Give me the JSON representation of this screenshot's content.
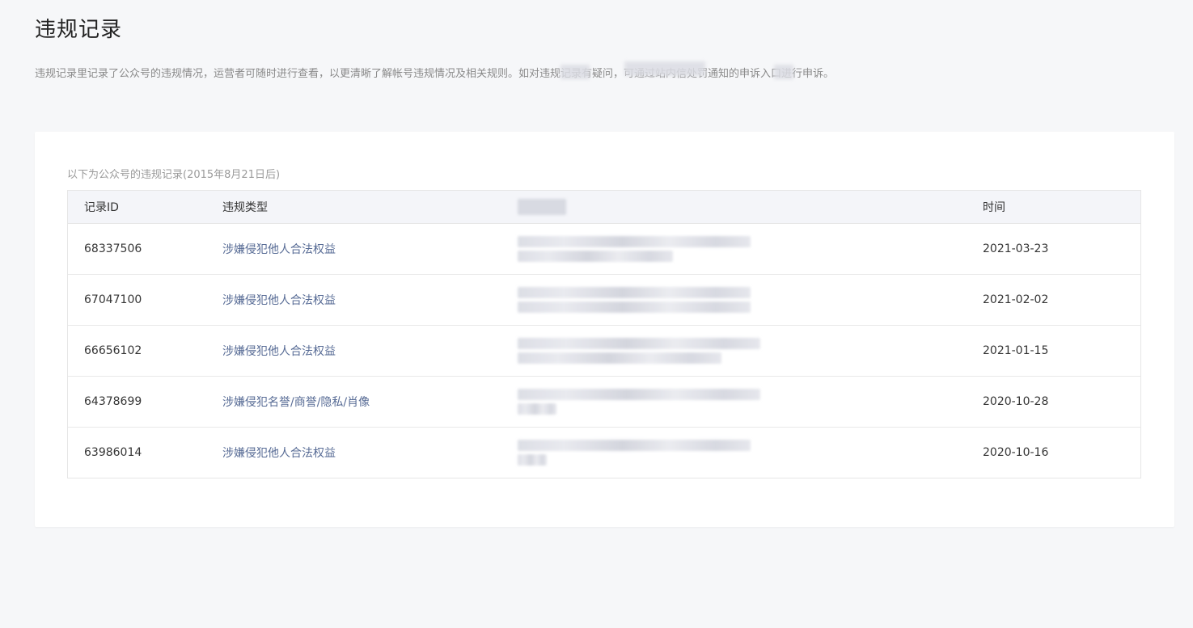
{
  "page": {
    "title": "违规记录",
    "description": "违规记录里记录了公众号的违规情况，运营者可随时进行查看，以更清晰了解帐号违规情况及相关规则。如对违规记录有疑问，可通过站内信处罚通知的申诉入口进行申诉。"
  },
  "table": {
    "caption": "以下为公众号的违规记录(2015年8月21日后)",
    "headers": {
      "id": "记录ID",
      "type": "违规类型",
      "desc": "",
      "time": "时间"
    },
    "rows": [
      {
        "id": "68337506",
        "type": "涉嫌侵犯他人合法权益",
        "time": "2021-03-23"
      },
      {
        "id": "67047100",
        "type": "涉嫌侵犯他人合法权益",
        "time": "2021-02-02"
      },
      {
        "id": "66656102",
        "type": "涉嫌侵犯他人合法权益",
        "time": "2021-01-15"
      },
      {
        "id": "64378699",
        "type": "涉嫌侵犯名誉/商誉/隐私/肖像",
        "time": "2020-10-28"
      },
      {
        "id": "63986014",
        "type": "涉嫌侵犯他人合法权益",
        "time": "2020-10-16"
      }
    ]
  },
  "colors": {
    "background": "#f6f7f9",
    "link": "#576b95",
    "header_bg": "#f4f5f9"
  }
}
